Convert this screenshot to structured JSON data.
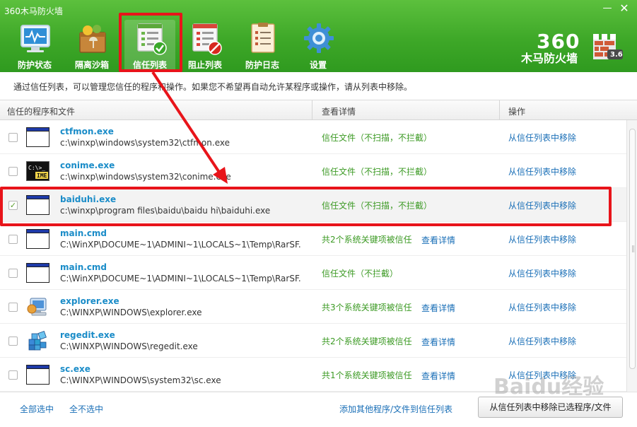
{
  "window": {
    "title": "360木马防火墙",
    "minimize": "—",
    "close": "✕"
  },
  "nav": [
    {
      "label": "防护状态",
      "icon": "monitor-icon"
    },
    {
      "label": "隔离沙箱",
      "icon": "sandbox-icon"
    },
    {
      "label": "信任列表",
      "icon": "trust-list-icon",
      "active": true
    },
    {
      "label": "阻止列表",
      "icon": "block-list-icon"
    },
    {
      "label": "防护日志",
      "icon": "log-icon"
    },
    {
      "label": "设置",
      "icon": "gear-icon"
    }
  ],
  "brand": {
    "number": "360",
    "name": "木马防火墙",
    "version": "3.6"
  },
  "description": "通过信任列表，可以管理您信任的程序和操作。如果您不希望再自动允许某程序或操作，请从列表中移除。",
  "table": {
    "headers": [
      "信任的程序和文件",
      "查看详情",
      "操作"
    ],
    "rows": [
      {
        "name": "ctfmon.exe",
        "path": "c:\\winxp\\windows\\system32\\ctfmon.exe",
        "detail": "信任文件（不扫描，不拦截）",
        "link": "",
        "action": "从信任列表中移除",
        "checked": false,
        "icon": "window-icon"
      },
      {
        "name": "conime.exe",
        "path": "c:\\winxp\\windows\\system32\\conime.exe",
        "detail": "信任文件（不扫描，不拦截）",
        "link": "",
        "action": "从信任列表中移除",
        "checked": false,
        "icon": "ime-icon"
      },
      {
        "name": "baiduhi.exe",
        "path": "c:\\winxp\\program files\\baidu\\baidu hi\\baiduhi.exe",
        "detail": "信任文件（不扫描，不拦截）",
        "link": "",
        "action": "从信任列表中移除",
        "checked": true,
        "icon": "window-icon"
      },
      {
        "name": "main.cmd",
        "path": "C:\\WinXP\\DOCUME~1\\ADMINI~1\\LOCALS~1\\Temp\\RarSF...",
        "detail": "共2个系统关键项被信任",
        "link": "查看详情",
        "action": "从信任列表中移除",
        "checked": false,
        "icon": "window-icon"
      },
      {
        "name": "main.cmd",
        "path": "C:\\WinXP\\DOCUME~1\\ADMINI~1\\LOCALS~1\\Temp\\RarSF...",
        "detail": "信任文件（不拦截）",
        "link": "",
        "action": "从信任列表中移除",
        "checked": false,
        "icon": "window-icon"
      },
      {
        "name": "explorer.exe",
        "path": "C:\\WINXP\\WINDOWS\\explorer.exe",
        "detail": "共3个系统关键项被信任",
        "link": "查看详情",
        "action": "从信任列表中移除",
        "checked": false,
        "icon": "explorer-icon"
      },
      {
        "name": "regedit.exe",
        "path": "C:\\WINXP\\WINDOWS\\regedit.exe",
        "detail": "共2个系统关键项被信任",
        "link": "查看详情",
        "action": "从信任列表中移除",
        "checked": false,
        "icon": "regedit-icon"
      },
      {
        "name": "sc.exe",
        "path": "C:\\WINXP\\WINDOWS\\system32\\sc.exe",
        "detail": "共1个系统关键项被信任",
        "link": "查看详情",
        "action": "从信任列表中移除",
        "checked": false,
        "icon": "window-icon"
      }
    ]
  },
  "footer": {
    "select_all": "全部选中",
    "select_none": "全不选中",
    "add_link": "添加其他程序/文件到信任列表",
    "remove_button": "从信任列表中移除已选程序/文件"
  },
  "watermark": "Baidu经验",
  "colors": {
    "header_green": "#3ea828",
    "link_blue": "#1a6fb7",
    "name_blue": "#1a8cc8",
    "detail_green": "#3c9a24",
    "annotation_red": "#e8141a"
  }
}
